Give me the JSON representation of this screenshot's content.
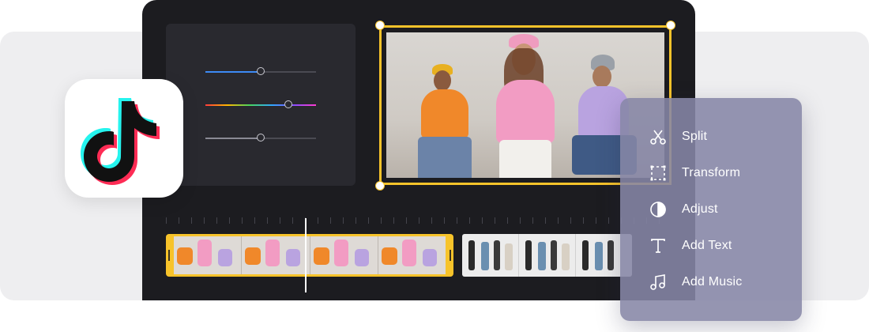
{
  "context_menu": {
    "items": [
      {
        "label": "Split",
        "icon": "scissors-icon"
      },
      {
        "label": "Transform",
        "icon": "transform-icon"
      },
      {
        "label": "Adjust",
        "icon": "contrast-icon"
      },
      {
        "label": "Add Text",
        "icon": "text-icon"
      },
      {
        "label": "Add Music",
        "icon": "music-note-icon"
      }
    ]
  },
  "adjust_panel": {
    "sliders": [
      {
        "name": "slider-blue",
        "value": 0.5,
        "fill_color": "#3d8bf5"
      },
      {
        "name": "slider-hue",
        "value": 0.75,
        "fill_color": "rainbow"
      },
      {
        "name": "slider-gray",
        "value": 0.5,
        "fill_color": "#8a8a94"
      }
    ]
  },
  "timeline": {
    "selected_clip_color": "#f7c32a",
    "playhead_color": "#ffffff"
  },
  "colors": {
    "accent": "#f7c32a",
    "editor_bg": "#1c1c20",
    "menu_bg": "#8686a6"
  },
  "app_icon": "tiktok-logo-icon"
}
